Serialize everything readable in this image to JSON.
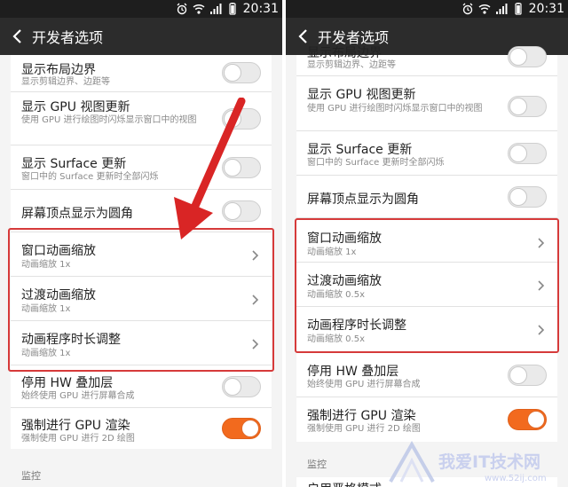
{
  "status": {
    "time": "20:31"
  },
  "header": {
    "title": "开发者选项"
  },
  "left": {
    "rows": [
      {
        "title": "显示布局边界",
        "subtitle": "显示剪辑边界、边距等"
      },
      {
        "title": "显示 GPU 视图更新",
        "subtitle": "使用 GPU 进行绘图时闪烁显示窗口中的视图"
      },
      {
        "title": "显示 Surface 更新",
        "subtitle": "窗口中的 Surface 更新时全部闪烁"
      },
      {
        "title": "屏幕顶点显示为圆角",
        "subtitle": ""
      },
      {
        "title": "窗口动画缩放",
        "subtitle": "动画缩放 1x"
      },
      {
        "title": "过渡动画缩放",
        "subtitle": "动画缩放 1x"
      },
      {
        "title": "动画程序时长调整",
        "subtitle": "动画缩放 1x"
      },
      {
        "title": "停用 HW 叠加层",
        "subtitle": "始终使用 GPU 进行屏幕合成"
      },
      {
        "title": "强制进行 GPU 渲染",
        "subtitle": "强制使用 GPU 进行 2D 绘图"
      }
    ],
    "section": "监控"
  },
  "right": {
    "rows": [
      {
        "title": "显示布局边界",
        "subtitle": "显示剪辑边界、边距等"
      },
      {
        "title": "显示 GPU 视图更新",
        "subtitle": "使用 GPU 进行绘图时闪烁显示窗口中的视图"
      },
      {
        "title": "显示 Surface 更新",
        "subtitle": "窗口中的 Surface 更新时全部闪烁"
      },
      {
        "title": "屏幕顶点显示为圆角",
        "subtitle": ""
      },
      {
        "title": "窗口动画缩放",
        "subtitle": "动画缩放 1x"
      },
      {
        "title": "过渡动画缩放",
        "subtitle": "动画缩放 0.5x"
      },
      {
        "title": "动画程序时长调整",
        "subtitle": "动画缩放 0.5x"
      },
      {
        "title": "停用 HW 叠加层",
        "subtitle": "始终使用 GPU 进行屏幕合成"
      },
      {
        "title": "强制进行 GPU 渲染",
        "subtitle": "强制使用 GPU 进行 2D 绘图"
      }
    ],
    "section": "监控",
    "cut_title": "启用严格模式"
  },
  "toggles": {
    "force_gpu": true,
    "others": false
  },
  "colors": {
    "accent": "#f26a1e",
    "highlight": "#d63a3a",
    "titlebar": "#2c2c2c",
    "arrow": "#d92525"
  },
  "watermark": {
    "text": "我爱IT技术网",
    "url": "www.52ij.com"
  }
}
